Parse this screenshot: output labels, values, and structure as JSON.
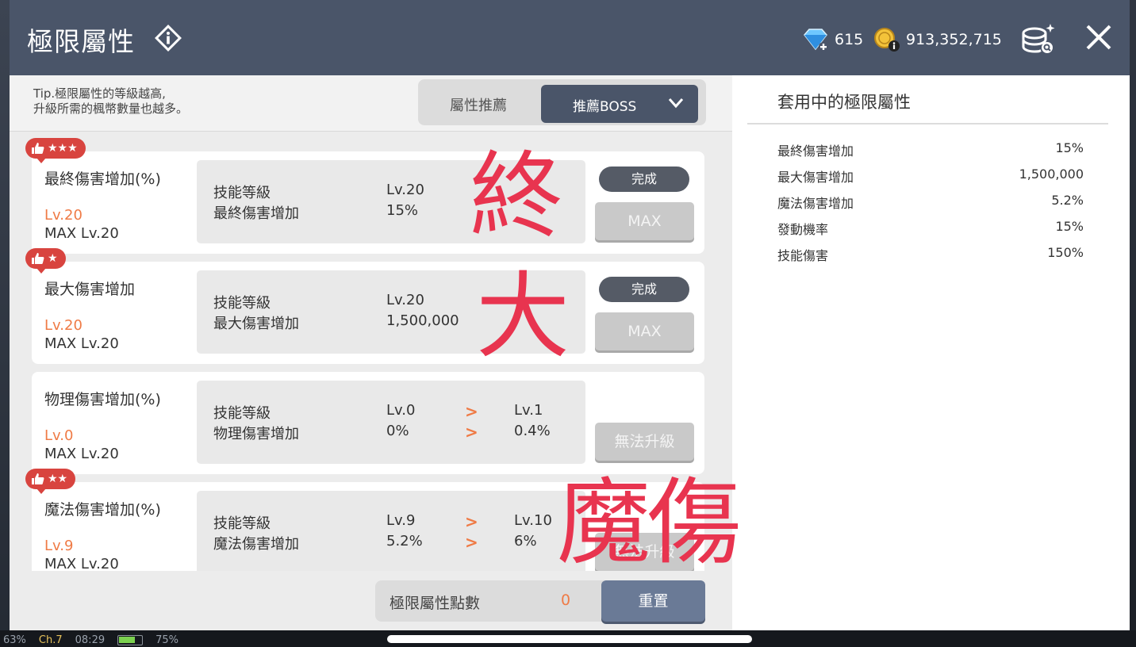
{
  "header": {
    "title": "極限屬性",
    "gem_count": "615",
    "coin_count": "913,352,715"
  },
  "tip": {
    "line1": "Tip.極限屬性的等級越高,",
    "line2": "升級所需的楓幣數量也越多。"
  },
  "recommend": {
    "label": "屬性推薦",
    "selected": "推薦BOSS"
  },
  "cards": [
    {
      "name": "最終傷害增加(%)",
      "level": "Lv.20",
      "max_level": "MAX Lv.20",
      "stars": "★★★",
      "info_label1": "技能等級",
      "info_label2": "最終傷害增加",
      "current_level": "Lv.20",
      "current_value": "15%",
      "status": "完成",
      "button": "MAX"
    },
    {
      "name": "最大傷害增加",
      "level": "Lv.20",
      "max_level": "MAX Lv.20",
      "stars": "★",
      "info_label1": "技能等級",
      "info_label2": "最大傷害增加",
      "current_level": "Lv.20",
      "current_value": "1,500,000",
      "status": "完成",
      "button": "MAX"
    },
    {
      "name": "物理傷害增加(%)",
      "level": "Lv.0",
      "max_level": "MAX Lv.20",
      "info_label1": "技能等級",
      "info_label2": "物理傷害增加",
      "current_level": "Lv.0",
      "current_value": "0%",
      "next_level": "Lv.1",
      "next_value": "0.4%",
      "button": "無法升級"
    },
    {
      "name": "魔法傷害增加(%)",
      "level": "Lv.9",
      "max_level": "MAX Lv.20",
      "stars": "★★",
      "info_label1": "技能等級",
      "info_label2": "魔法傷害增加",
      "current_level": "Lv.9",
      "current_value": "5.2%",
      "next_level": "Lv.10",
      "next_value": "6%",
      "button": "無法升級"
    }
  ],
  "points": {
    "label": "極限屬性點數",
    "value": "0",
    "reset": "重置"
  },
  "applied": {
    "title": "套用中的極限屬性",
    "stats": [
      {
        "name": "最終傷害增加",
        "value": "15%"
      },
      {
        "name": "最大傷害增加",
        "value": "1,500,000"
      },
      {
        "name": "魔法傷害增加",
        "value": "5.2%"
      },
      {
        "name": "發動機率",
        "value": "15%"
      },
      {
        "name": "技能傷害",
        "value": "150%"
      }
    ]
  },
  "annotations": {
    "a1": "終",
    "a2": "大",
    "a3": "魔傷"
  },
  "statusbar": {
    "percent": "63%",
    "channel": "Ch.7",
    "time": "08:29",
    "battery": "75%",
    "battery_level": 0.75
  },
  "colors": {
    "header": "#4a5569",
    "accent_orange": "#ef7b46",
    "badge_red": "#d8443f",
    "annotation_red": "#e8344f"
  }
}
